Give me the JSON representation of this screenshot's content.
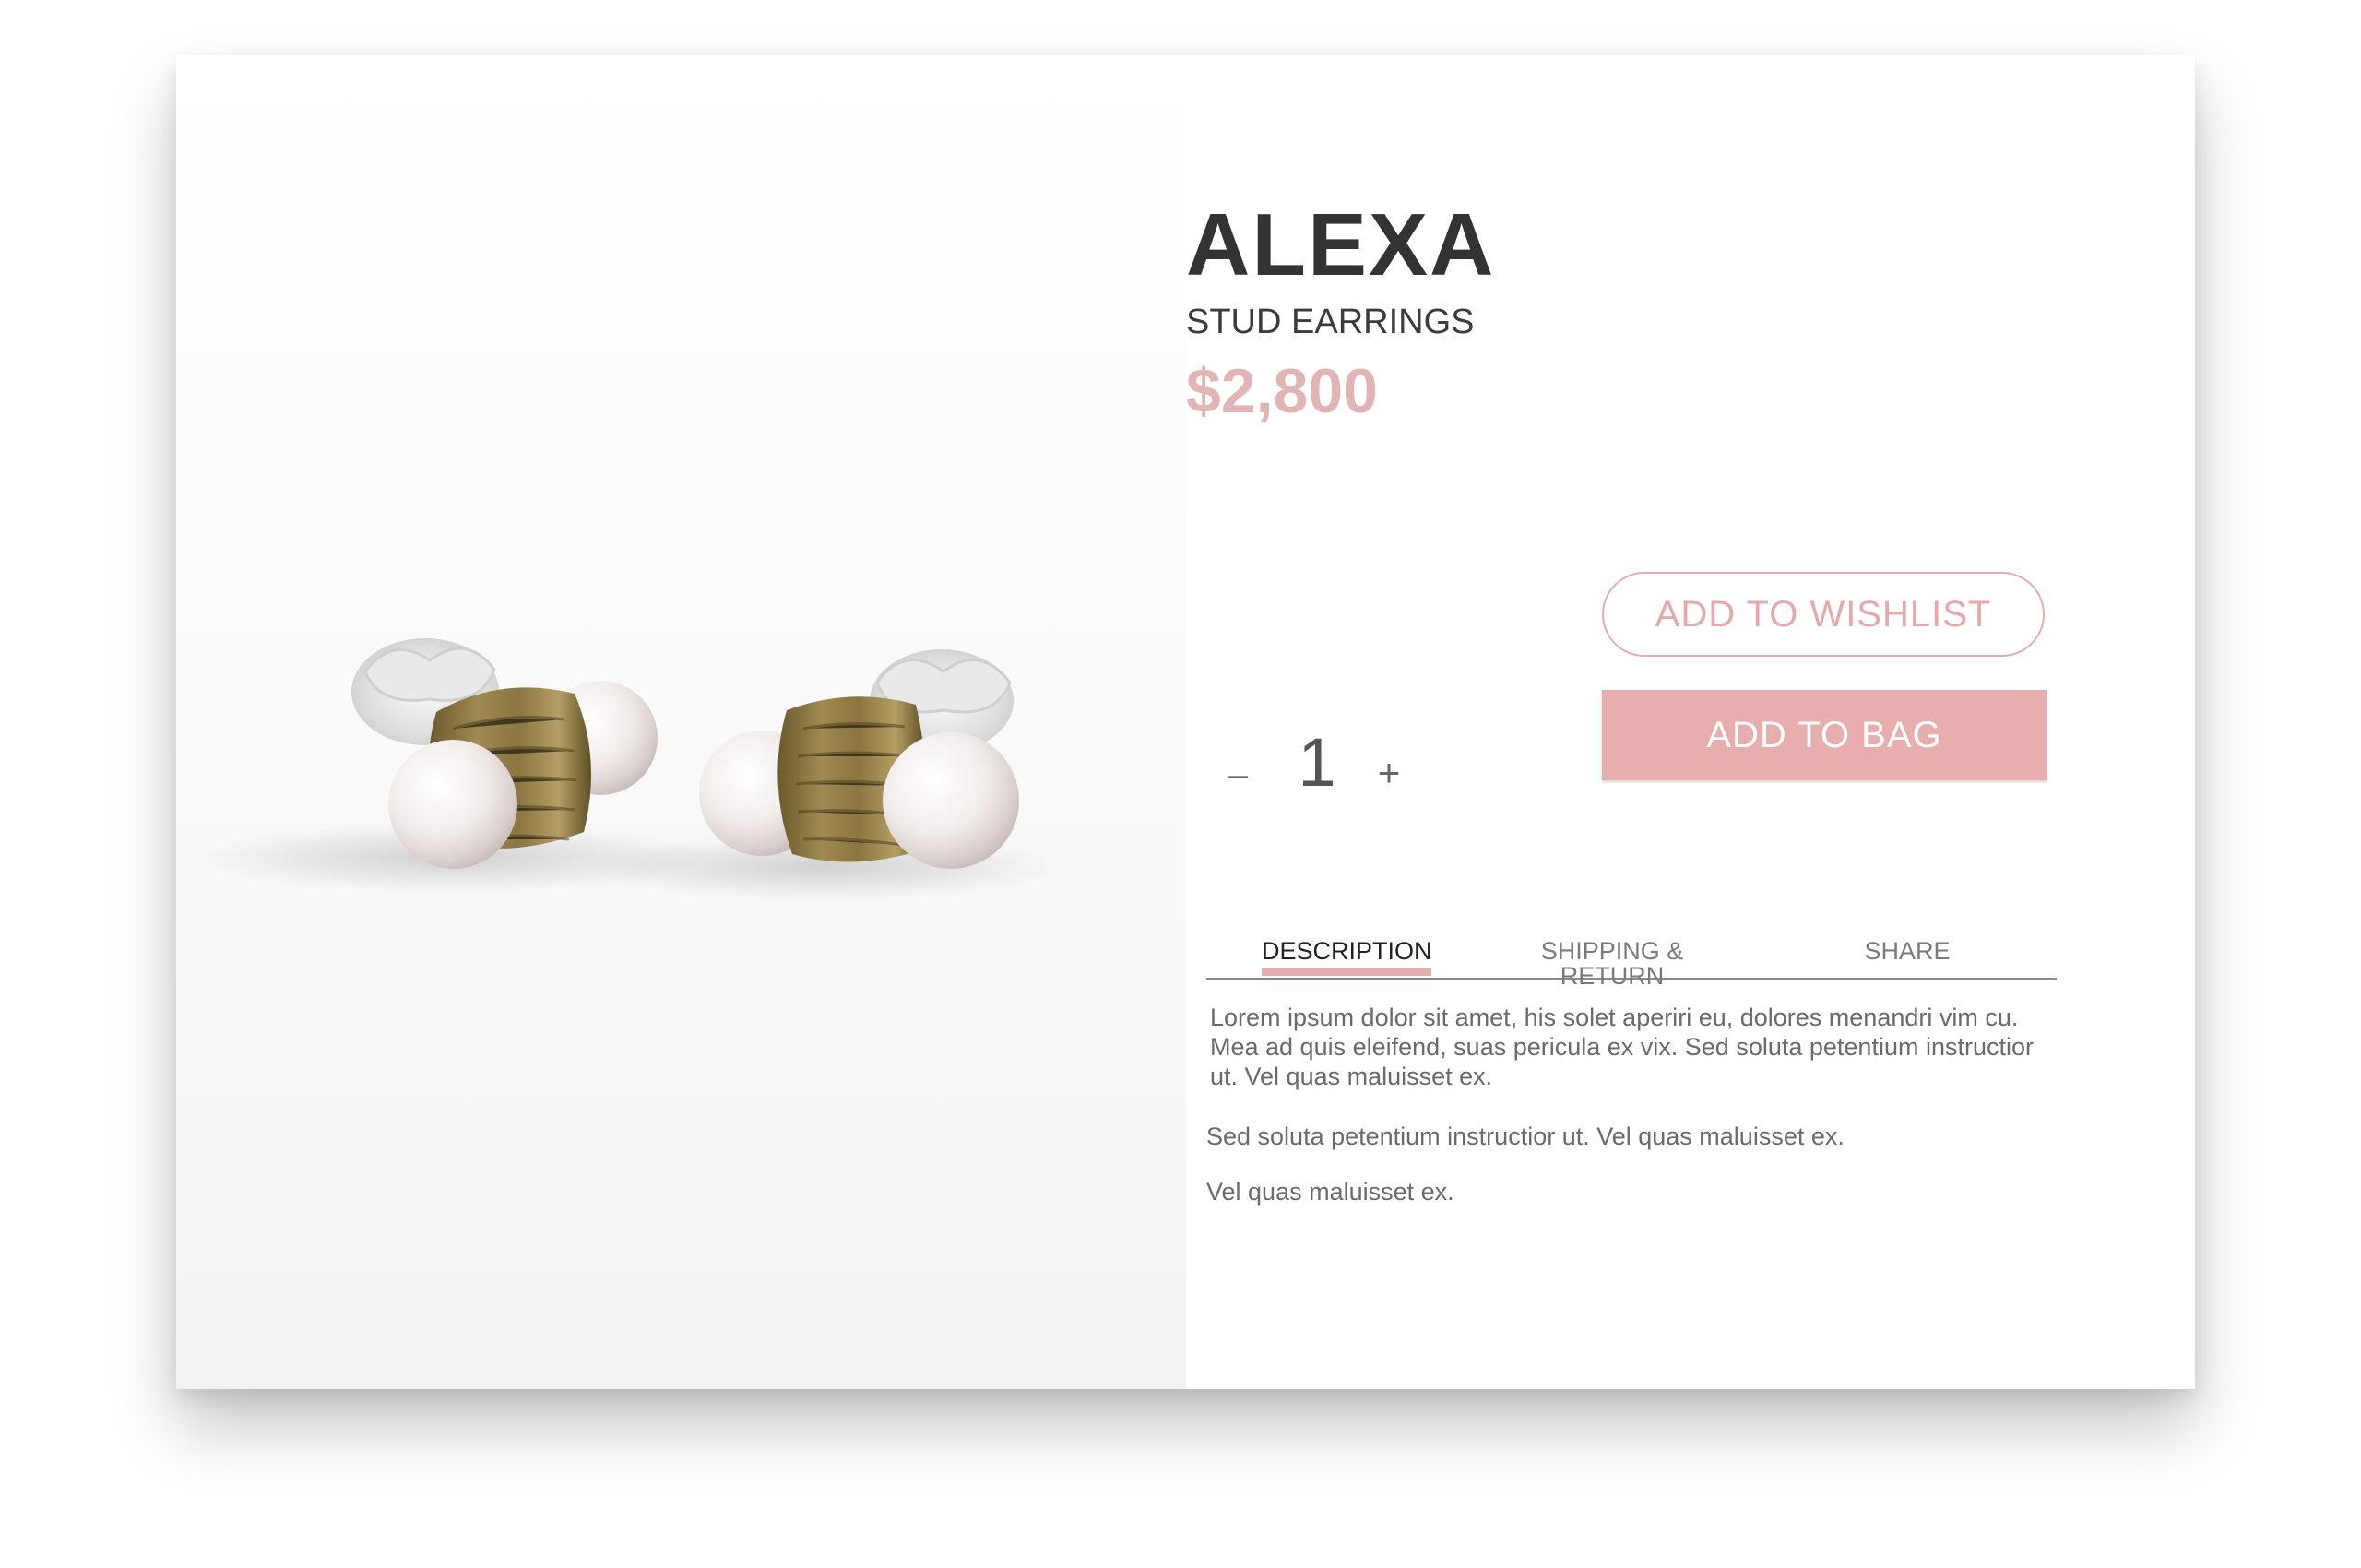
{
  "product": {
    "name": "ALEXA",
    "category": "STUD EARRINGS",
    "price": "$2,800",
    "image": "pearl-stud-earrings-photo"
  },
  "actions": {
    "wishlist_label": "ADD TO WISHLIST",
    "add_to_bag_label": "ADD TO BAG"
  },
  "quantity": {
    "decrement": "–",
    "value": "1",
    "increment": "+"
  },
  "tabs": [
    {
      "label": "DESCRIPTION",
      "active": true
    },
    {
      "label": "SHIPPING & RETURN",
      "active": false
    },
    {
      "label": "SHARE",
      "active": false
    }
  ],
  "description": {
    "paragraphs": [
      "Lorem ipsum dolor sit amet, his solet aperiri eu, dolores menandri vim cu. Mea ad quis eleifend, suas pericula ex vix. Sed soluta petentium instructior ut. Vel quas maluisset ex.",
      "Sed soluta petentium instructior ut. Vel quas maluisset ex.",
      "Vel quas maluisset ex."
    ]
  },
  "colors": {
    "accent": "#e8adad",
    "price": "#e2b5b5",
    "title": "#333333",
    "text": "#6a6a6a"
  }
}
